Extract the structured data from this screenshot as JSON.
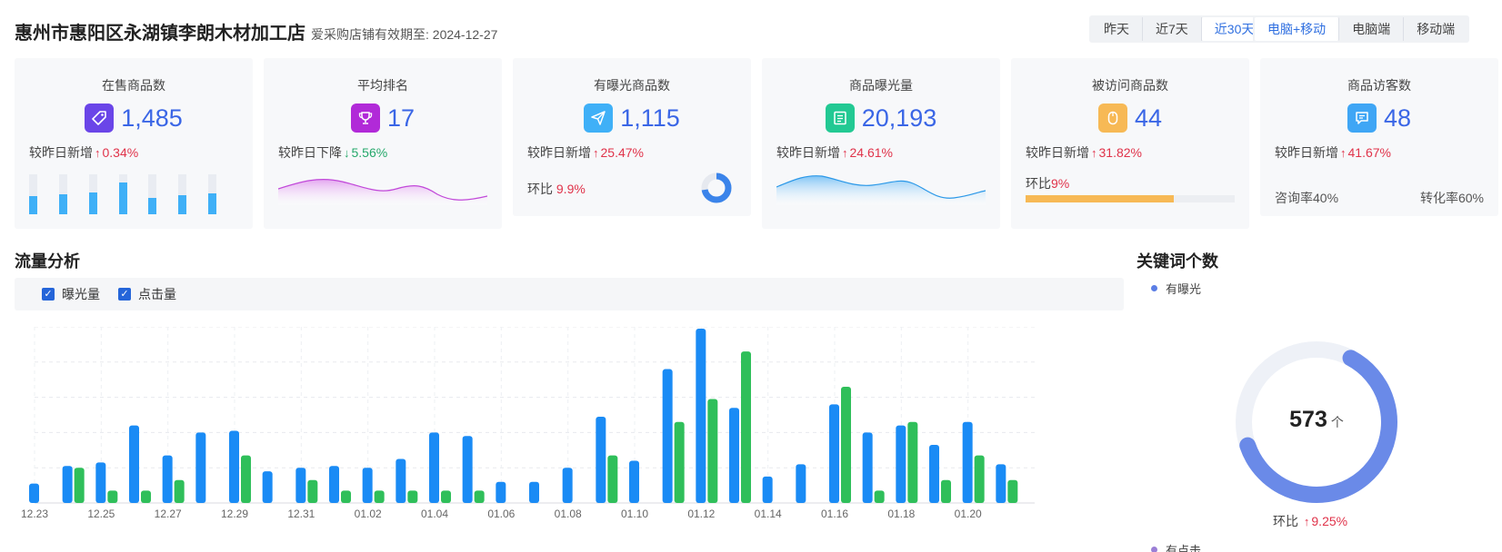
{
  "header": {
    "shop_name": "惠州市惠阳区永湖镇李朗木材加工店",
    "validity": "爱采购店铺有效期至: 2024-12-27"
  },
  "date_range": {
    "options": [
      "昨天",
      "近7天",
      "近30天"
    ],
    "selected": "近30天"
  },
  "device": {
    "options": [
      "电脑+移动",
      "电脑端",
      "移动端"
    ],
    "selected": "电脑+移动"
  },
  "cards": [
    {
      "title": "在售商品数",
      "value": "1,485",
      "change_label": "较昨日新增",
      "change_dir": "up",
      "change_value": "0.34%",
      "icon": "tag-icon",
      "icon_color": "#6a45e8",
      "mini_bars": [
        0.45,
        0.5,
        0.55,
        0.8,
        0.42,
        0.48,
        0.52
      ]
    },
    {
      "title": "平均排名",
      "value": "17",
      "change_label": "较昨日下降",
      "change_dir": "down",
      "change_value": "5.56%",
      "icon": "trophy-icon",
      "icon_color": "#b12ad8"
    },
    {
      "title": "有曝光商品数",
      "value": "1,115",
      "change_label": "较昨日新增",
      "change_dir": "up",
      "change_value": "25.47%",
      "icon": "send-icon",
      "icon_color": "#3fb0f7",
      "ratio_label": "环比",
      "ratio_value": "9.9%"
    },
    {
      "title": "商品曝光量",
      "value": "20,193",
      "change_label": "较昨日新增",
      "change_dir": "up",
      "change_value": "24.61%",
      "icon": "document-icon",
      "icon_color": "#22c993"
    },
    {
      "title": "被访问商品数",
      "value": "44",
      "change_label": "较昨日新增",
      "change_dir": "up",
      "change_value": "31.82%",
      "icon": "mouse-icon",
      "icon_color": "#f7b955",
      "ratio_label": "环比",
      "ratio_value": "9%",
      "progress": 0.71
    },
    {
      "title": "商品访客数",
      "value": "48",
      "change_label": "较昨日新增",
      "change_dir": "up",
      "change_value": "41.67%",
      "icon": "message-icon",
      "icon_color": "#3fa6f5",
      "consult_rate": "咨询率40%",
      "convert_rate": "转化率60%"
    }
  ],
  "traffic": {
    "title": "流量分析",
    "legend": [
      {
        "label": "曝光量",
        "checked": true,
        "color": "#1a8bf5"
      },
      {
        "label": "点击量",
        "checked": true,
        "color": "#2fbf5a"
      }
    ]
  },
  "chart_data": {
    "type": "bar",
    "categories": [
      "12.23",
      "12.24",
      "12.25",
      "12.26",
      "12.27",
      "12.28",
      "12.29",
      "12.30",
      "12.31",
      "01.01",
      "01.02",
      "01.03",
      "01.04",
      "01.05",
      "01.06",
      "01.07",
      "01.08",
      "01.09",
      "01.10",
      "01.11",
      "01.12",
      "01.13",
      "01.14",
      "01.15",
      "01.16",
      "01.17",
      "01.18",
      "01.19",
      "01.20",
      "01.21"
    ],
    "tick_labels": [
      "12.23",
      "12.25",
      "12.27",
      "12.29",
      "12.31",
      "01.02",
      "01.04",
      "01.06",
      "01.08",
      "01.10",
      "01.12",
      "01.14",
      "01.16",
      "01.18",
      "01.20"
    ],
    "series": [
      {
        "name": "曝光量",
        "color": "#1a8bf5",
        "values": [
          11,
          21,
          23,
          44,
          27,
          40,
          41,
          18,
          20,
          21,
          20,
          25,
          40,
          38,
          12,
          12,
          20,
          49,
          24,
          76,
          99,
          54,
          15,
          22,
          56,
          40,
          44,
          33,
          46,
          22
        ]
      },
      {
        "name": "点击量",
        "color": "#2fbf5a",
        "values": [
          0,
          20,
          7,
          7,
          13,
          0,
          27,
          0,
          13,
          7,
          7,
          7,
          7,
          7,
          0,
          0,
          0,
          27,
          0,
          46,
          59,
          86,
          0,
          0,
          66,
          7,
          46,
          13,
          27,
          13
        ]
      }
    ],
    "ylim": [
      0,
      100
    ],
    "grid": true
  },
  "keywords": {
    "title": "关键词个数",
    "legend_top": {
      "label": "有曝光",
      "color": "#5b7ee5"
    },
    "legend_bottom": {
      "label": "有点击",
      "color": "#9b7fd6"
    },
    "total": "573",
    "unit": "个",
    "exposure_fraction": 0.62,
    "ratio_label": "环比",
    "ratio_value": "9.25%",
    "ratio_dir": "up"
  }
}
